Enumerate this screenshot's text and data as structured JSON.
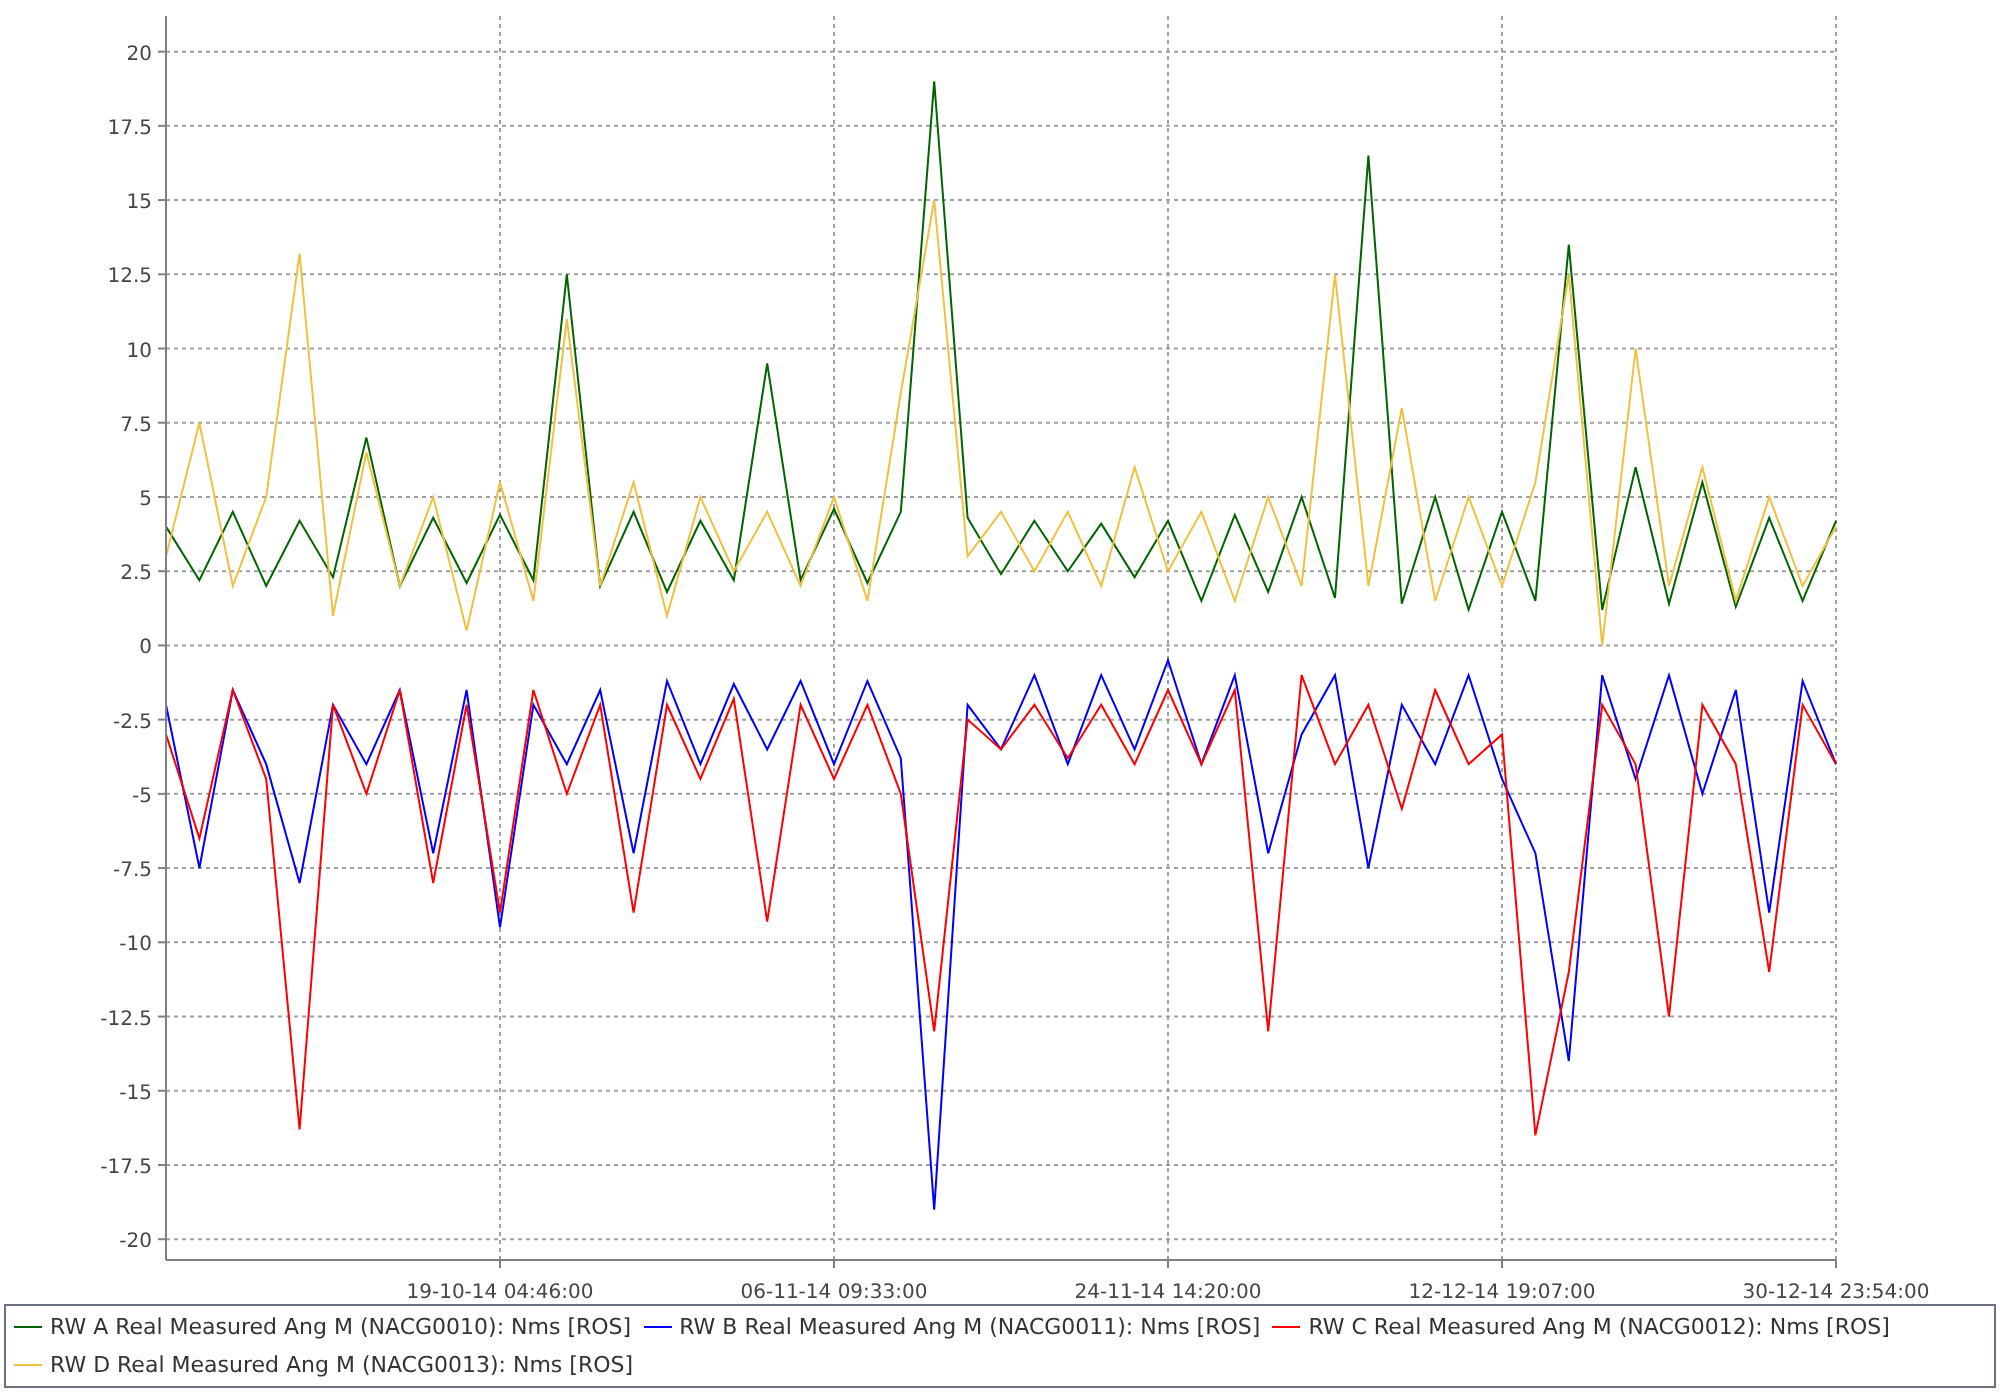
{
  "chart_data": {
    "type": "line",
    "grid": true,
    "categories": [
      null,
      null,
      null,
      null,
      null,
      null,
      null,
      null,
      null,
      null,
      "19-10-14 04:46:00",
      null,
      null,
      null,
      null,
      null,
      null,
      null,
      null,
      null,
      "06-11-14 09:33:00",
      null,
      null,
      null,
      null,
      null,
      null,
      null,
      null,
      null,
      "24-11-14 14:20:00",
      null,
      null,
      null,
      null,
      null,
      null,
      null,
      null,
      null,
      "12-12-14 19:07:00",
      null,
      null,
      null,
      null,
      null,
      null,
      null,
      null,
      null,
      "30-12-14 23:54:00"
    ],
    "ylim": [
      -20.7,
      21.2
    ],
    "yticks": [
      -20,
      -17.5,
      -15,
      -12.5,
      -10,
      -7.5,
      -5,
      -2.5,
      0,
      2.5,
      5,
      7.5,
      10,
      12.5,
      15,
      17.5,
      20
    ],
    "series": [
      {
        "name": "RW A Real Measured Ang M (NACG0010): Nms [ROS]",
        "color": "#006400",
        "values": [
          4,
          2.2,
          4.5,
          2,
          4.2,
          2.3,
          7,
          2,
          4.3,
          2.1,
          4.4,
          2.2,
          12.5,
          2,
          4.5,
          1.8,
          4.2,
          2.2,
          9.5,
          2.2,
          4.6,
          2.1,
          4.5,
          19,
          4.3,
          2.4,
          4.2,
          2.5,
          4.1,
          2.3,
          4.2,
          1.5,
          4.4,
          1.8,
          5,
          1.6,
          16.5,
          1.4,
          5,
          1.2,
          4.5,
          1.5,
          13.5,
          1.2,
          6,
          1.4,
          5.5,
          1.3,
          4.3,
          1.5,
          4.2
        ]
      },
      {
        "name": "RW B Real Measured Ang M (NACG0011): Nms [ROS]",
        "color": "#0000ff",
        "values": [
          -2,
          -7.5,
          -1.5,
          -4,
          -8,
          -2,
          -4,
          -1.5,
          -7,
          -1.5,
          -9.5,
          -2,
          -4,
          -1.5,
          -7,
          -1.2,
          -4,
          -1.3,
          -3.5,
          -1.2,
          -4,
          -1.2,
          -3.8,
          -19,
          -2,
          -3.5,
          -1,
          -4,
          -1,
          -3.5,
          -0.5,
          -4,
          -1,
          -7,
          -3,
          -1,
          -7.5,
          -2,
          -4,
          -1,
          -4.5,
          -7,
          -14,
          -1,
          -4.5,
          -1,
          -5,
          -1.5,
          -9,
          -1.2,
          -4
        ]
      },
      {
        "name": "RW C Real Measured Ang M (NACG0012): Nms [ROS]",
        "color": "#ff0000",
        "values": [
          -3,
          -6.5,
          -1.5,
          -4.5,
          -16.3,
          -2,
          -5,
          -1.5,
          -8,
          -2,
          -9,
          -1.5,
          -5,
          -2,
          -9,
          -2,
          -4.5,
          -1.8,
          -9.3,
          -2,
          -4.5,
          -2,
          -5,
          -13,
          -2.5,
          -3.5,
          -2,
          -3.8,
          -2,
          -4,
          -1.5,
          -4,
          -1.5,
          -13,
          -1,
          -4,
          -2,
          -5.5,
          -1.5,
          -4,
          -3,
          -16.5,
          -11,
          -2,
          -4,
          -12.5,
          -2,
          -4,
          -11,
          -2,
          -4
        ]
      },
      {
        "name": "RW D Real Measured Ang M (NACG0013): Nms [ROS]",
        "color": "#f0c040",
        "values": [
          3,
          7.5,
          2,
          5,
          13.2,
          1,
          6.5,
          2,
          5,
          0.5,
          5.5,
          1.5,
          11,
          2,
          5.5,
          1,
          5,
          2.5,
          4.5,
          2,
          5,
          1.5,
          8.5,
          15,
          3,
          4.5,
          2.5,
          4.5,
          2,
          6,
          2.5,
          4.5,
          1.5,
          5,
          2,
          12.5,
          2,
          8,
          1.5,
          5,
          2,
          5.5,
          12.5,
          0,
          10,
          2,
          6,
          1.5,
          5,
          2,
          4
        ]
      }
    ]
  }
}
